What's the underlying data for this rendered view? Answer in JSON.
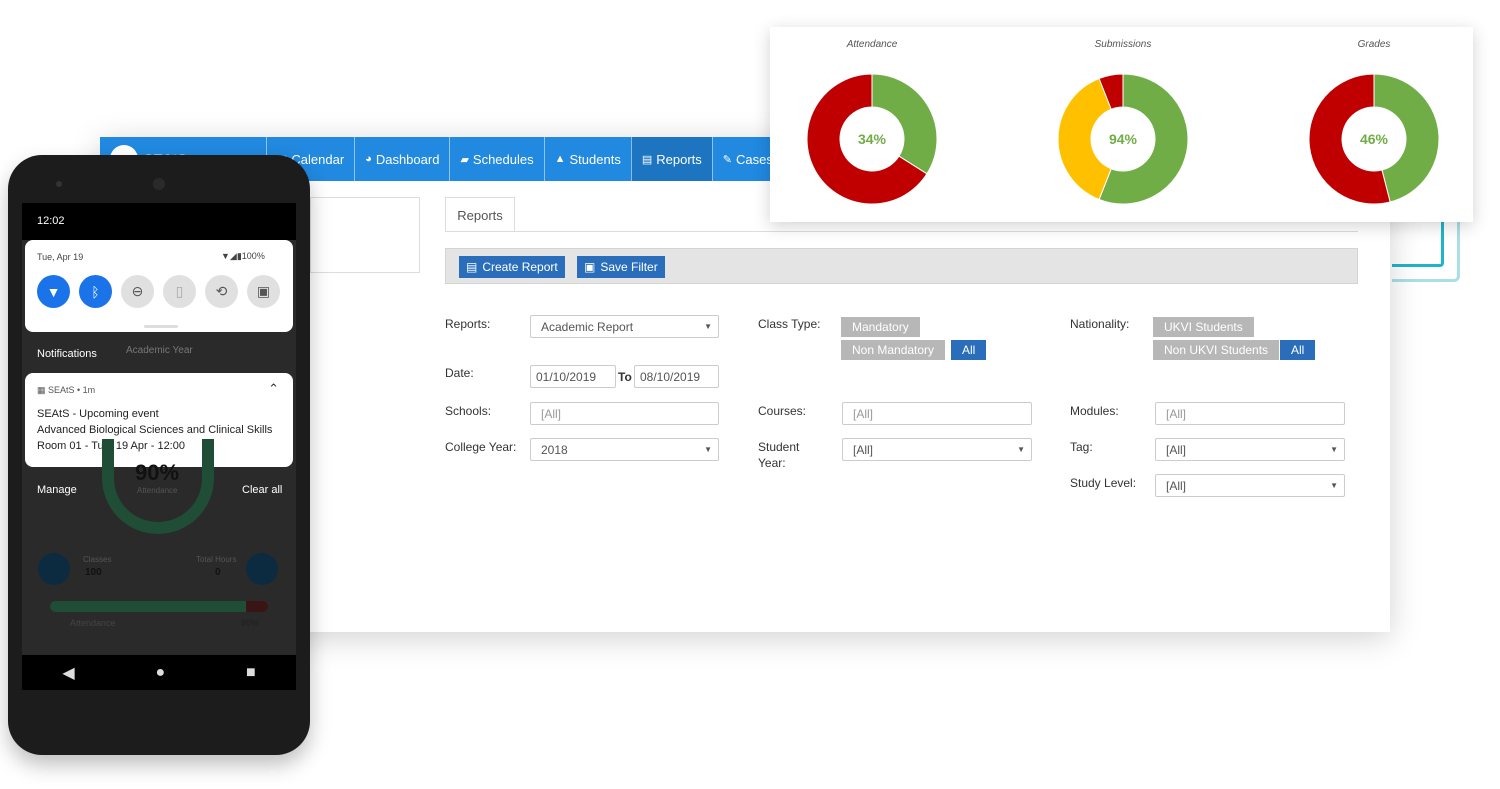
{
  "app": {
    "logo_text": "SEAtS",
    "nav": [
      {
        "icon": "calendar-icon",
        "glyph": "▦",
        "label": "Calendar"
      },
      {
        "icon": "dashboard-icon",
        "glyph": "◕",
        "label": "Dashboard"
      },
      {
        "icon": "book-icon",
        "glyph": "▰",
        "label": "Schedules"
      },
      {
        "icon": "graduation-cap-icon",
        "glyph": "▲",
        "label": "Students"
      },
      {
        "icon": "file-icon",
        "glyph": "▤",
        "label": "Reports",
        "active": true
      },
      {
        "icon": "edit-icon",
        "glyph": "✎",
        "label": "Cases"
      }
    ],
    "tab": "Reports",
    "toolbar": {
      "create": "Create Report",
      "save": "Save Filter"
    },
    "form": {
      "reports_label": "Reports:",
      "reports_value": "Academic Report",
      "class_type_label": "Class Type:",
      "class_type_options": [
        "Mandatory",
        "Non Mandatory",
        "All"
      ],
      "class_type_selected": "All",
      "nationality_label": "Nationality:",
      "nationality_options": [
        "UKVI Students",
        "Non UKVI Students",
        "All"
      ],
      "nationality_selected": "All",
      "date_label": "Date:",
      "date_from": "01/10/2019",
      "date_to_label": "To",
      "date_to": "08/10/2019",
      "schools_label": "Schools:",
      "schools_ph": "[All]",
      "courses_label": "Courses:",
      "courses_ph": "[All]",
      "modules_label": "Modules:",
      "modules_ph": "[All]",
      "college_year_label": "College Year:",
      "college_year_value": "2018",
      "student_year_label": "Student Year:",
      "student_year_value": "[All]",
      "tag_label": "Tag:",
      "tag_value": "[All]",
      "study_level_label": "Study Level:",
      "study_level_value": "[All]"
    },
    "accent": "#2189e0"
  },
  "chart_data": [
    {
      "type": "pie",
      "donut": true,
      "title": "Attendance",
      "center_label": "34%",
      "slices": [
        {
          "value": 34,
          "color": "#70ad47"
        },
        {
          "value": 66,
          "color": "#c00000"
        }
      ]
    },
    {
      "type": "pie",
      "donut": true,
      "title": "Submissions",
      "center_label": "94%",
      "slices": [
        {
          "value": 56,
          "color": "#70ad47"
        },
        {
          "value": 38,
          "color": "#ffc000"
        },
        {
          "value": 6,
          "color": "#c00000"
        }
      ]
    },
    {
      "type": "pie",
      "donut": true,
      "title": "Grades",
      "center_label": "46%",
      "slices": [
        {
          "value": 46,
          "color": "#70ad47"
        },
        {
          "value": 54,
          "color": "#c00000"
        }
      ]
    }
  ],
  "phone": {
    "time": "12:02",
    "date": "Tue, Apr 19",
    "battery": "100%",
    "quick_settings": [
      "wifi-icon",
      "bluetooth-icon",
      "do-not-disturb-icon",
      "flashlight-icon",
      "auto-rotate-icon",
      "battery-saver-icon"
    ],
    "notifications_label": "Notifications",
    "bg_header": "Academic Year",
    "notification": {
      "app": "SEAtS • 1m",
      "title": "SEAtS - Upcoming event",
      "line1": "Advanced Biological Sciences and Clinical Skills",
      "line2": "Room 01 - Tue, 19 Apr - 12:00"
    },
    "manage": "Manage",
    "clear_all": "Clear all",
    "bg": {
      "big_value": "90%",
      "big_label": "Attendance",
      "classes_label": "Classes",
      "classes_value": "100",
      "hours_label": "Total Hours",
      "hours_value": "0",
      "bar_label": "Attendance",
      "bar_value": "90%",
      "bar_fraction": 0.9
    }
  }
}
